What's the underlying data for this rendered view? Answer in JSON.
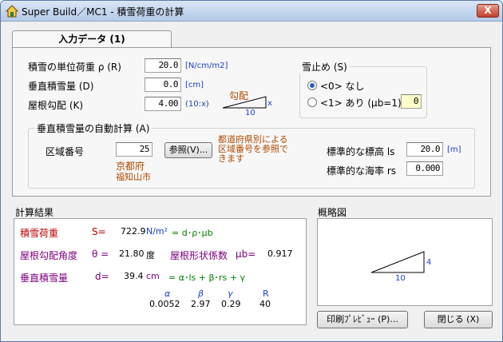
{
  "window": {
    "title": "Super Build／MC1 - 積雪荷重の計算",
    "close_label": "X"
  },
  "tab": {
    "label": "入力データ (1)"
  },
  "inputs": {
    "unit_weight": {
      "label": "積雪の単位荷重 ρ (R)",
      "value": "20.0",
      "unit": "[N/cm/m2]"
    },
    "depth": {
      "label": "垂直積雪量 (D)",
      "value": "0.0",
      "unit": "[cm]"
    },
    "slope": {
      "label": "屋根勾配 (K)",
      "value": "4.00",
      "unit": "(10:x)"
    },
    "slope_diagram": {
      "caption": "勾配",
      "x": "x",
      "base": "10"
    }
  },
  "snow_stop": {
    "title": "雪止め (S)",
    "opt0": "<0> なし",
    "opt1": "<1> あり (μb=1)",
    "mu_value": "0"
  },
  "auto_calc": {
    "title": "垂直積雪量の自動計算 (A)",
    "region_label": "区域番号",
    "region_value": "25",
    "ref_button": "参照(V)...",
    "note": [
      "都道府県別による",
      "区域番号を参照で",
      "きます"
    ],
    "prefecture": "京都府",
    "city": "福知山市",
    "height_label": "標準的な標高 ls",
    "height_value": "20.0",
    "height_unit": "[m]",
    "sea_label": "標準的な海率 rs",
    "sea_value": "0.000"
  },
  "results": {
    "header": "計算結果",
    "load_label": "積雪荷重",
    "load_symbol": "S=",
    "load_value": "722.9",
    "load_unit": "N/m²",
    "load_formula": "= d･ρ･μb",
    "angle_label": "屋根勾配角度",
    "angle_symbol": "θ =",
    "angle_value": "21.80",
    "angle_unit": "度",
    "shape_label": "屋根形状係数",
    "shape_symbol": "μb=",
    "shape_value": "0.917",
    "depth_label": "垂直積雪量",
    "depth_symbol": "d=",
    "depth_value": "39.4",
    "depth_unit": "cm",
    "depth_formula": "= α･ls + β･rs + γ",
    "coef_headers": [
      "α",
      "β",
      "γ",
      "R"
    ],
    "coef_values": [
      "0.0052",
      "2.97",
      "0.29",
      "40"
    ]
  },
  "sketch": {
    "header": "概略図",
    "base": "10",
    "height": "4"
  },
  "buttons": {
    "preview": "印刷ﾌﾟﾚﾋﾞｭｰ (P)...",
    "close": "閉じる (X)"
  },
  "colors": {
    "red": "#c00000",
    "purple": "#800080",
    "green": "#008000",
    "blue": "#1a3fd0",
    "note": "#b04a00"
  }
}
